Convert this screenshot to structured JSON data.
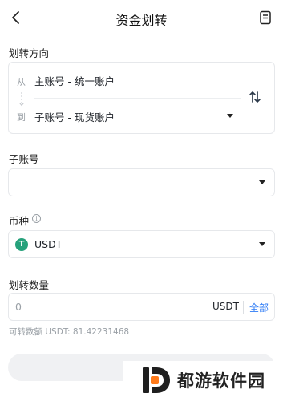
{
  "header": {
    "title": "资金划转"
  },
  "direction": {
    "label": "划转方向",
    "from_tag": "从",
    "to_tag": "到",
    "from_value": "主账号 - 统一账户",
    "to_value": "子账号 - 现货账户"
  },
  "sub_account": {
    "label": "子账号",
    "value": ""
  },
  "currency": {
    "label": "币种",
    "info_glyph": "i",
    "coin_glyph": "T",
    "value": "USDT",
    "coin_color": "#26a17b"
  },
  "amount": {
    "label": "划转数量",
    "placeholder": "0",
    "unit": "USDT",
    "all_label": "全部",
    "available_text": "可转数额 USDT: 81.42231468"
  },
  "colors": {
    "accent": "#2f7cf6",
    "watermark_accent": "#ff7a1a"
  },
  "watermark": {
    "text": "都游软件园"
  }
}
